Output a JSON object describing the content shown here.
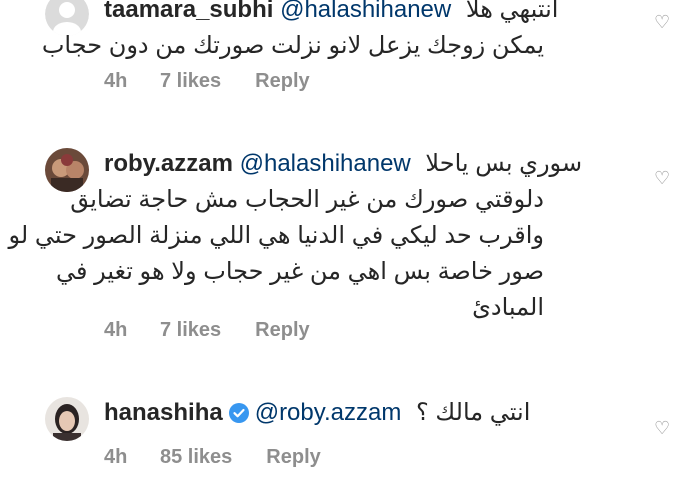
{
  "comments": [
    {
      "username": "taamara_subhi",
      "mention": "@halashihanew",
      "text_first": "انتبهي هلا",
      "text_lines": [
        "يمكن زوجك يزعل لانو نزلت صورتك من دون حجاب"
      ],
      "time": "4h",
      "likes": "7 likes",
      "reply": "Reply",
      "avatar": "default-avatar-icon"
    },
    {
      "username": "roby.azzam",
      "mention": "@halashihanew",
      "text_first": "سوري بس ياحلا",
      "text_lines": [
        "دلوقتي صورك من غير الحجاب مش حاجة تضايق",
        "واقرب حد ليكي في الدنيا هي اللي منزلة الصور حتي لو",
        "صور خاصة بس اهي من غير حجاب ولا هو تغير في",
        "المبادئ"
      ],
      "time": "4h",
      "likes": "7 likes",
      "reply": "Reply",
      "avatar": "user-photo-avatar"
    },
    {
      "username": "hanashiha",
      "mention": "@roby.azzam",
      "text_first": "انتي مالك ؟",
      "text_lines": [],
      "time": "4h",
      "likes": "85 likes",
      "reply": "Reply",
      "verified": true,
      "avatar": "user-photo-avatar"
    }
  ],
  "colors": {
    "username": "#262626",
    "mention": "#00376b",
    "meta": "#8e8e8e",
    "verified": "#3897f0"
  },
  "icons": {
    "like": "heart-outline-icon",
    "verified": "verified-badge-icon"
  }
}
